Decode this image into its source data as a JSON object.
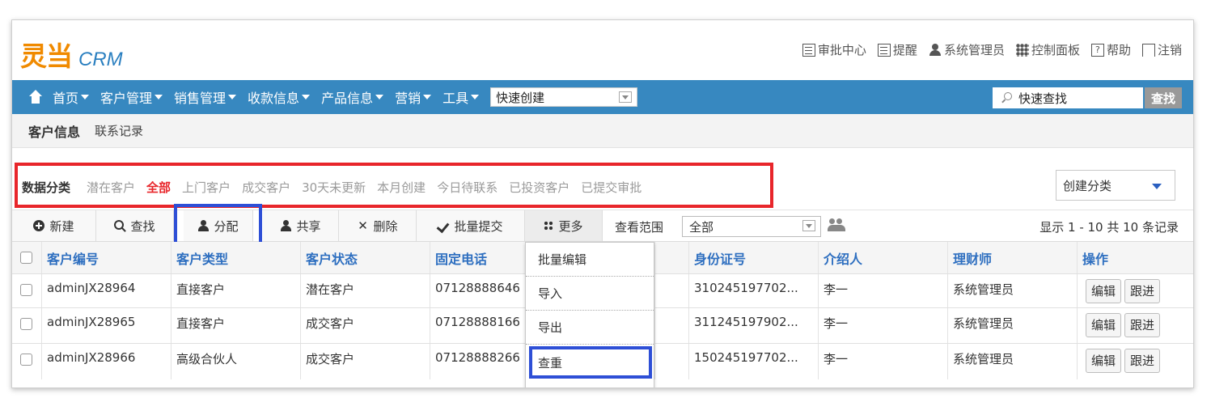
{
  "app": {
    "logo_mark": "灵当",
    "logo_suffix": "CRM"
  },
  "top_links": [
    {
      "label": "审批中心",
      "icon": "doc-icon"
    },
    {
      "label": "提醒",
      "icon": "doc-icon"
    },
    {
      "label": "系统管理员",
      "icon": "user-icon"
    },
    {
      "label": "控制面板",
      "icon": "grid-icon"
    },
    {
      "label": "帮助",
      "icon": "help-icon"
    },
    {
      "label": "注销",
      "icon": "logout-icon"
    }
  ],
  "nav": {
    "items": [
      "首页",
      "客户管理",
      "销售管理",
      "收款信息",
      "产品信息",
      "营销",
      "工具"
    ],
    "quick_create": "快速创建",
    "search_placeholder": "快速查找",
    "search_button": "查找"
  },
  "subtabs": [
    "客户信息",
    "联系记录"
  ],
  "categories": {
    "title": "数据分类",
    "items": [
      "潜在客户",
      "全部",
      "上门客户",
      "成交客户",
      "30天未更新",
      "本月创建",
      "今日待联系",
      "已投资客户",
      "已提交审批"
    ],
    "active": "全部",
    "select_label": "创建分类"
  },
  "toolbar": {
    "buttons": [
      "新建",
      "查找",
      "分配",
      "共享",
      "删除",
      "批量提交",
      "更多"
    ],
    "scope_label": "查看范围",
    "scope_value": "全部",
    "records": "显示 1 - 10 共 10 条记录"
  },
  "table": {
    "columns": [
      "客户编号",
      "客户类型",
      "客户状态",
      "固定电话",
      "",
      "身份证号",
      "介绍人",
      "理财师",
      "操作"
    ],
    "rows": [
      [
        "adminJX28964",
        "直接客户",
        "潜在客户",
        "07128888646",
        "",
        "310245197702...",
        "李一",
        "系统管理员"
      ],
      [
        "adminJX28965",
        "直接客户",
        "成交客户",
        "07128888166",
        "",
        "311245197902...",
        "李一",
        "系统管理员"
      ],
      [
        "adminJX28966",
        "高级合伙人",
        "成交客户",
        "07128888266",
        "",
        "150245197702...",
        "李一",
        "系统管理员"
      ]
    ],
    "row_actions": [
      "编辑",
      "跟进"
    ]
  },
  "more_menu": [
    "批量编辑",
    "导入",
    "导出",
    "查重"
  ],
  "colors": {
    "nav": "#3788c0",
    "accent_red": "#e8262b",
    "highlight_blue": "#2e4fd6",
    "logo": "#f08a00"
  }
}
